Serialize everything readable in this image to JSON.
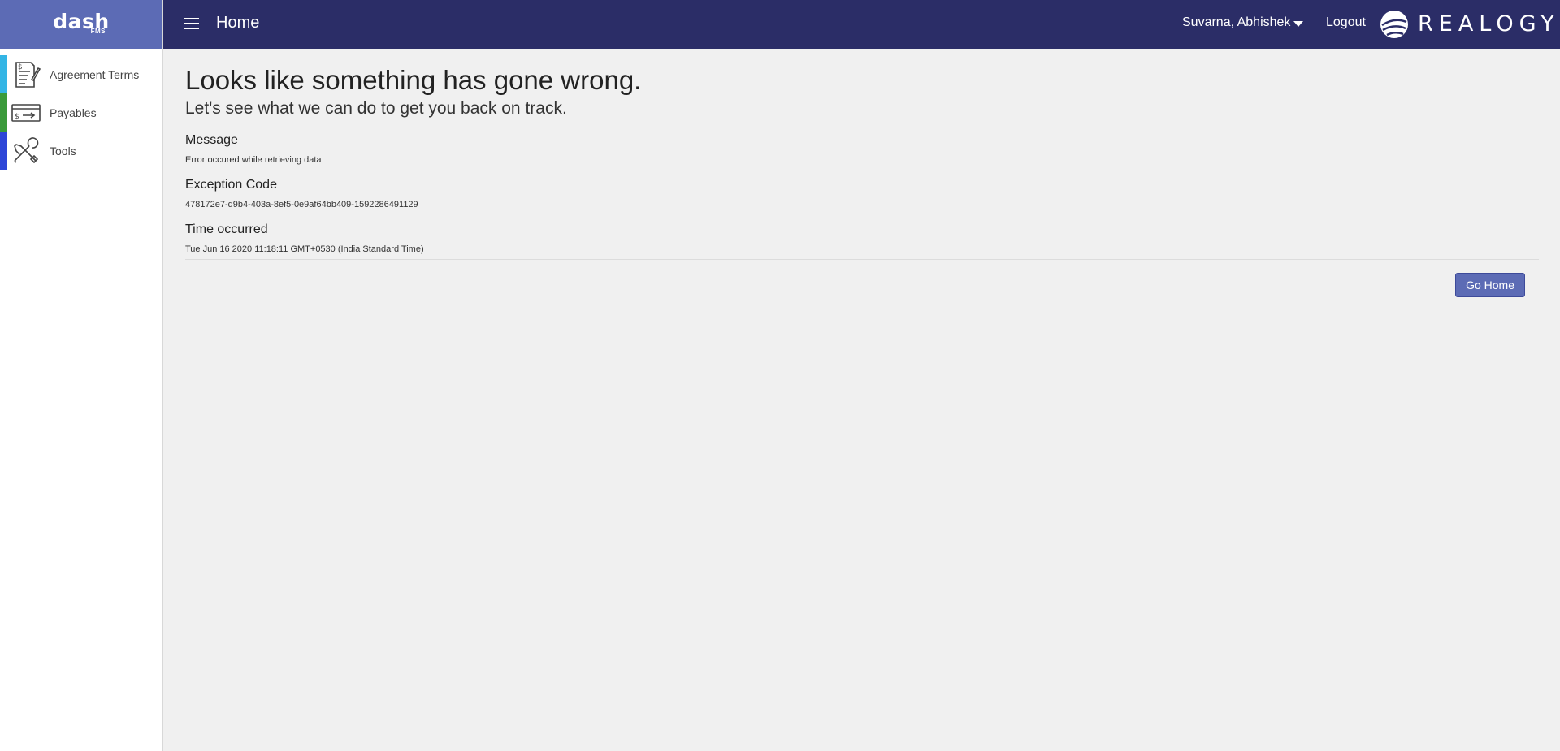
{
  "sidebar": {
    "logo_main": "dash",
    "logo_sub": "FMS",
    "items": [
      {
        "label": "Agreement Terms",
        "color": "#33b5e5",
        "icon": "agreement-icon"
      },
      {
        "label": "Payables",
        "color": "#3a9a3a",
        "icon": "payables-icon"
      },
      {
        "label": "Tools",
        "color": "#2e46d8",
        "icon": "tools-icon"
      }
    ]
  },
  "header": {
    "title": "Home",
    "user_name": "Suvarna, Abhishek",
    "logout_label": "Logout",
    "brand_name": "REALOGY"
  },
  "error": {
    "heading": "Looks like something has gone wrong.",
    "subheading": "Let's see what we can do to get you back on track.",
    "message_label": "Message",
    "message_value": "Error occured while retrieving data",
    "code_label": "Exception Code",
    "code_value": "478172e7-d9b4-403a-8ef5-0e9af64bb409-1592286491129",
    "time_label": "Time occurred",
    "time_value": "Tue Jun 16 2020 11:18:11 GMT+0530 (India Standard Time)",
    "go_home_label": "Go Home"
  },
  "colors": {
    "topbar": "#2b2d67",
    "logo_bg": "#5c6bb5",
    "button_bg": "#5c6bb5"
  }
}
